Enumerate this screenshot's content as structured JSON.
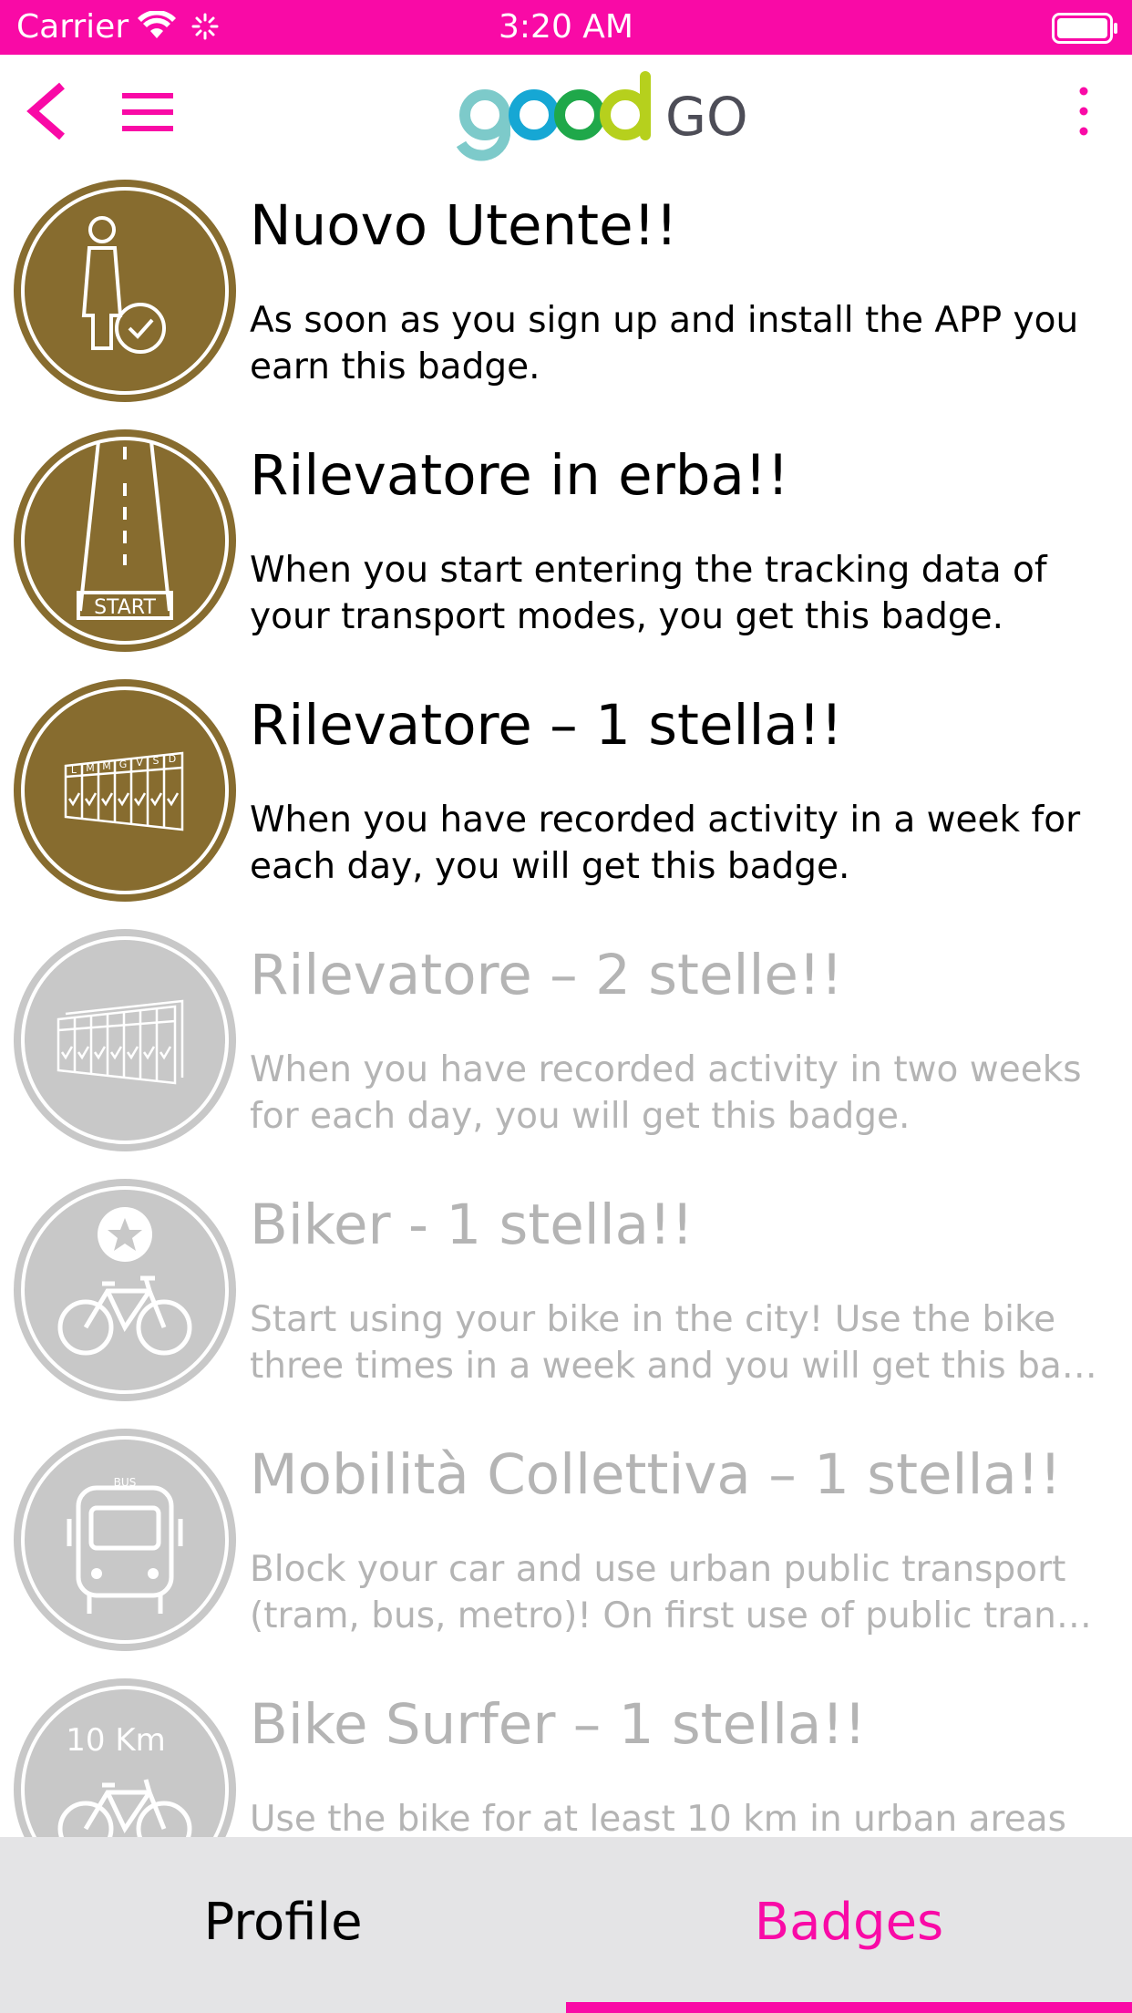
{
  "status_bar": {
    "carrier": "Carrier",
    "time": "3:20 AM"
  },
  "header": {
    "logo_text": "goodGO",
    "icons": [
      "back-chevron-icon",
      "hamburger-menu-icon",
      "more-vertical-icon"
    ]
  },
  "colors": {
    "accent": "#f90aa6",
    "earned_badge": "#876c2f",
    "locked_badge": "#c8c8c8",
    "locked_text": "#b4b4b4",
    "tabbar_bg": "#e4e4e6"
  },
  "badges": [
    {
      "title": "Nuovo Utente!!",
      "desc_lines": [
        "As soon as you sign up and install the APP you",
        "earn this badge."
      ],
      "earned": true,
      "icon": "new-user-icon"
    },
    {
      "title": "Rilevatore in erba!!",
      "desc_lines": [
        "When you start entering the tracking data of",
        "your transport modes, you get this badge."
      ],
      "earned": true,
      "icon": "start-road-icon",
      "icon_text": "START"
    },
    {
      "title": "Rilevatore – 1 stella!!",
      "desc_lines": [
        "When you have recorded activity in a week for",
        "each day, you will get this badge."
      ],
      "earned": true,
      "icon": "weekly-calendar-icon",
      "icon_text": [
        "L",
        "M",
        "M",
        "G",
        "V",
        "S",
        "D"
      ]
    },
    {
      "title": "Rilevatore – 2 stelle!!",
      "desc_lines": [
        "When you have recorded activity in two weeks",
        "for each day, you will get this badge."
      ],
      "earned": false,
      "icon": "weekly-calendar-icon"
    },
    {
      "title": "Biker - 1 stella!!",
      "desc_lines": [
        "Start using your bike in the city! Use the bike",
        "three times in a week and you will get this badge."
      ],
      "earned": false,
      "icon": "bike-star-icon"
    },
    {
      "title": "Mobilità Collettiva – 1 stella!!",
      "desc_lines": [
        "Block your car and use urban public transport",
        "(tram, bus, metro)! On first use of public transport you will get this badge."
      ],
      "earned": false,
      "icon": "bus-icon",
      "icon_text": "BUS"
    },
    {
      "title": "Bike Surfer – 1 stella!!",
      "desc_lines": [
        "Use the bike for at least 10 km in urban areas",
        ""
      ],
      "earned": false,
      "icon": "bike-10km-icon",
      "icon_text": "10 Km"
    }
  ],
  "tabs": [
    {
      "label": "Profile",
      "selected": false
    },
    {
      "label": "Badges",
      "selected": true
    }
  ]
}
